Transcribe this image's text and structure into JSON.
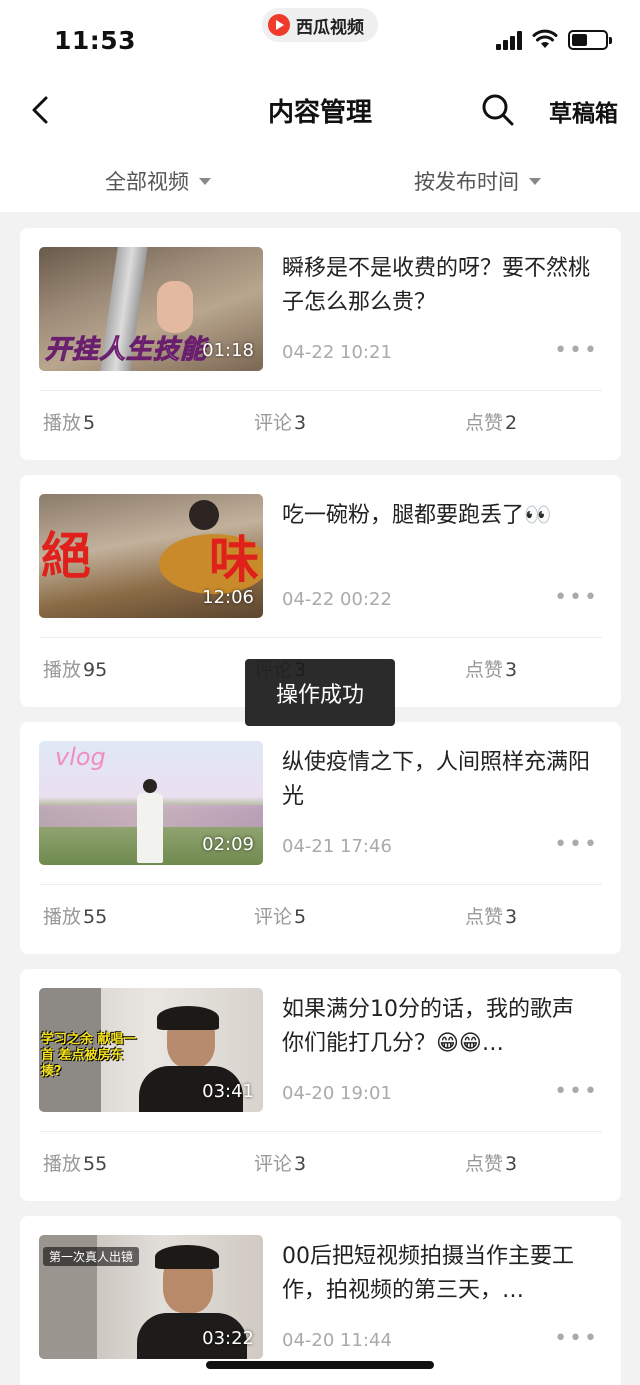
{
  "status_bar": {
    "time": "11:53",
    "app_name": "西瓜视频"
  },
  "nav": {
    "title": "内容管理",
    "drafts": "草稿箱",
    "back_icon": "chevron-left-icon",
    "search_icon": "search-icon"
  },
  "filters": {
    "left": "全部视频",
    "right": "按发布时间"
  },
  "labels": {
    "play": "播放",
    "comment": "评论",
    "like": "点赞"
  },
  "videos": [
    {
      "title": "瞬移是不是收费的呀？要不然桃子怎么那么贵？",
      "date": "04-22 10:21",
      "duration": "01:18",
      "overlay": "开挂人生技能",
      "plays": "5",
      "comments": "3",
      "likes": "2"
    },
    {
      "title": "吃一碗粉，腿都要跑丢了👀",
      "date": "04-22 00:22",
      "duration": "12:06",
      "overlay_left": "絕",
      "overlay_right": "味",
      "plays": "95",
      "comments": "3",
      "likes": "3"
    },
    {
      "title": "纵使疫情之下，人间照样充满阳光",
      "date": "04-21 17:46",
      "duration": "02:09",
      "overlay": "vlog",
      "plays": "55",
      "comments": "5",
      "likes": "3"
    },
    {
      "title": "如果满分10分的话，我的歌声你们能打几分？😁😁…",
      "date": "04-20 19:01",
      "duration": "03:41",
      "overlay": "学习之余 献唱一首 差点被房东揍?",
      "plays": "55",
      "comments": "3",
      "likes": "3"
    },
    {
      "title": "00后把短视频拍摄当作主要工作，拍视频的第三天，…",
      "date": "04-20 11:44",
      "duration": "03:22",
      "overlay": "第一次真人出镜",
      "plays": "",
      "comments": "",
      "likes": ""
    }
  ],
  "toast": "操作成功"
}
